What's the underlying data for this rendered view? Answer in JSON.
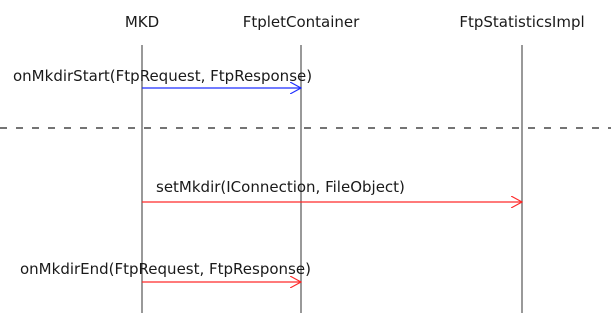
{
  "participants": [
    "MKD",
    "FtpletContainer",
    "FtpStatisticsImpl"
  ],
  "messages": [
    {
      "label": "onMkdirStart(FtpRequest, FtpResponse)",
      "from": "MKD",
      "to": "FtpletContainer",
      "color": "#1f2fff"
    },
    {
      "label": "setMkdir(IConnection, FileObject)",
      "from": "MKD",
      "to": "FtpStatisticsImpl",
      "color": "#ff2a2a"
    },
    {
      "label": "onMkdirEnd(FtpRequest, FtpResponse)",
      "from": "MKD",
      "to": "FtpletContainer",
      "color": "#ff2a2a"
    }
  ],
  "colors": {
    "lifeline": "#333333",
    "separator": "#222222",
    "text": "#1a1a1a"
  }
}
